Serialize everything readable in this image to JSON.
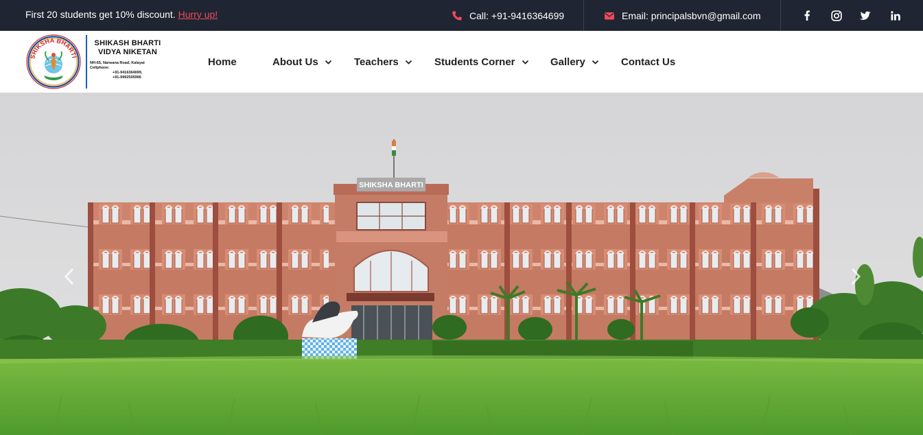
{
  "topbar": {
    "promo_text": "First 20 students get 10% discount.",
    "promo_link": "Hurry up!",
    "phone": "Call: +91-9416364699",
    "email": "Email: principalsbvn@gmail.com",
    "phone_icon": "phone-icon",
    "email_icon": "envelope-icon",
    "social": [
      "facebook-icon",
      "instagram-icon",
      "twitter-icon",
      "linkedin-icon"
    ],
    "accent_color": "#f04a5a",
    "background_color": "#1f2532"
  },
  "logo": {
    "ring_text": "SHIKSHA BHARTI",
    "name_line1": "SHIKASH BHARTI",
    "name_line2": "VIDYA NIKETAN",
    "address": "NH-65, Narwana Road, Kalayat",
    "phone_label": "Cellphone:",
    "phone1": "+91-9416364699,",
    "phone2": "+91-9992505996"
  },
  "nav": {
    "items": [
      {
        "label": "Home",
        "has_dropdown": false
      },
      {
        "label": "About Us",
        "has_dropdown": true
      },
      {
        "label": "Teachers",
        "has_dropdown": true
      },
      {
        "label": "Students Corner",
        "has_dropdown": true
      },
      {
        "label": "Gallery",
        "has_dropdown": true
      },
      {
        "label": "Contact Us",
        "has_dropdown": false
      }
    ]
  },
  "hero": {
    "building_sign": "SHIKSHA BHARTI",
    "prev_icon": "chevron-left-icon",
    "next_icon": "chevron-right-icon"
  }
}
